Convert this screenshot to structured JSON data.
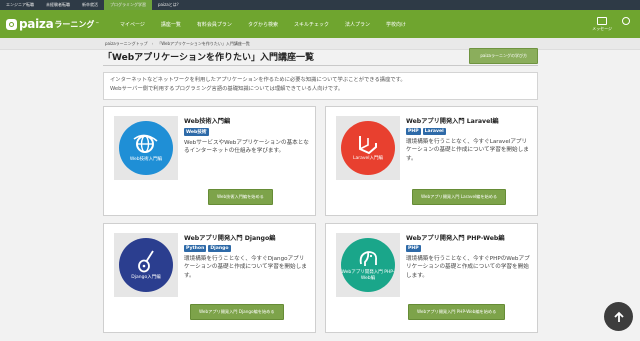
{
  "topbar": {
    "links": [
      "エンジニア転職",
      "未経験者転職",
      "新卒就活",
      "プログラミング学習",
      "paizaとは？"
    ],
    "active_index": 3
  },
  "header": {
    "logo_text": "paiza",
    "logo_sub": "ラーニング",
    "logo_tm": "™",
    "nav": [
      "マイページ",
      "講座一覧",
      "有料会員プラン",
      "タグから検索",
      "スキルチェック",
      "法人プラン",
      "学校向け"
    ],
    "icons": [
      {
        "name": "mail-icon",
        "label": "メッセージ"
      },
      {
        "name": "user-icon",
        "label": ""
      }
    ]
  },
  "breadcrumb": {
    "items": [
      "paizaラーニングトップ",
      "「Webアプリケーションを作りたい」入門講座一覧"
    ]
  },
  "page": {
    "title": "「Webアプリケーションを作りたい」入門講座一覧",
    "list_button": "paizaラーニングの学び方",
    "intro_lines": [
      "インターネットなどネットワークを利用したアプリケーションを作るために必要な知識について学ぶことができる講座です。",
      "Webサーバー側で利用するプログラミング言語の基礎知識については理解できている人向けです。"
    ]
  },
  "cards": [
    {
      "title": "Web技術入門編",
      "tags": [
        "Web技術"
      ],
      "desc": "WebサービスやWebアプリケーションの基本となるインターネットの仕組みを学びます。",
      "badge": "Web技術入門編",
      "button": "Web技術入門編を始める",
      "color": "#1f8fd6"
    },
    {
      "title": "Webアプリ開発入門 Laravel編",
      "tags": [
        "PHP",
        "Laravel"
      ],
      "desc": "環境構築を行うことなく、今すぐLaravelアプリケーションの基礎と作成について学習を開始します。",
      "badge": "Laravel入門編",
      "button": "Webアプリ開発入門 Laravel編を始める",
      "color": "#e8402f"
    },
    {
      "title": "Webアプリ開発入門 Django編",
      "tags": [
        "Python",
        "Django"
      ],
      "desc": "環境構築を行うことなく、今すぐDjangoアプリケーションの基礎と作成について学習を開始します。",
      "badge": "Django入門編",
      "button": "Webアプリ開発入門 Django編を始める",
      "color": "#2b3e8f"
    },
    {
      "title": "Webアプリ開発入門 PHP-Web編",
      "tags": [
        "PHP"
      ],
      "desc": "環境構築を行うことなく、今すぐPHPのWebアプリケーションの基礎と作成についての学習を開始します。",
      "badge": "Webアプリ開発入門 PHP-Web編",
      "button": "Webアプリ開発入門 PHP-Web編を始める",
      "color": "#1aa68a"
    }
  ]
}
